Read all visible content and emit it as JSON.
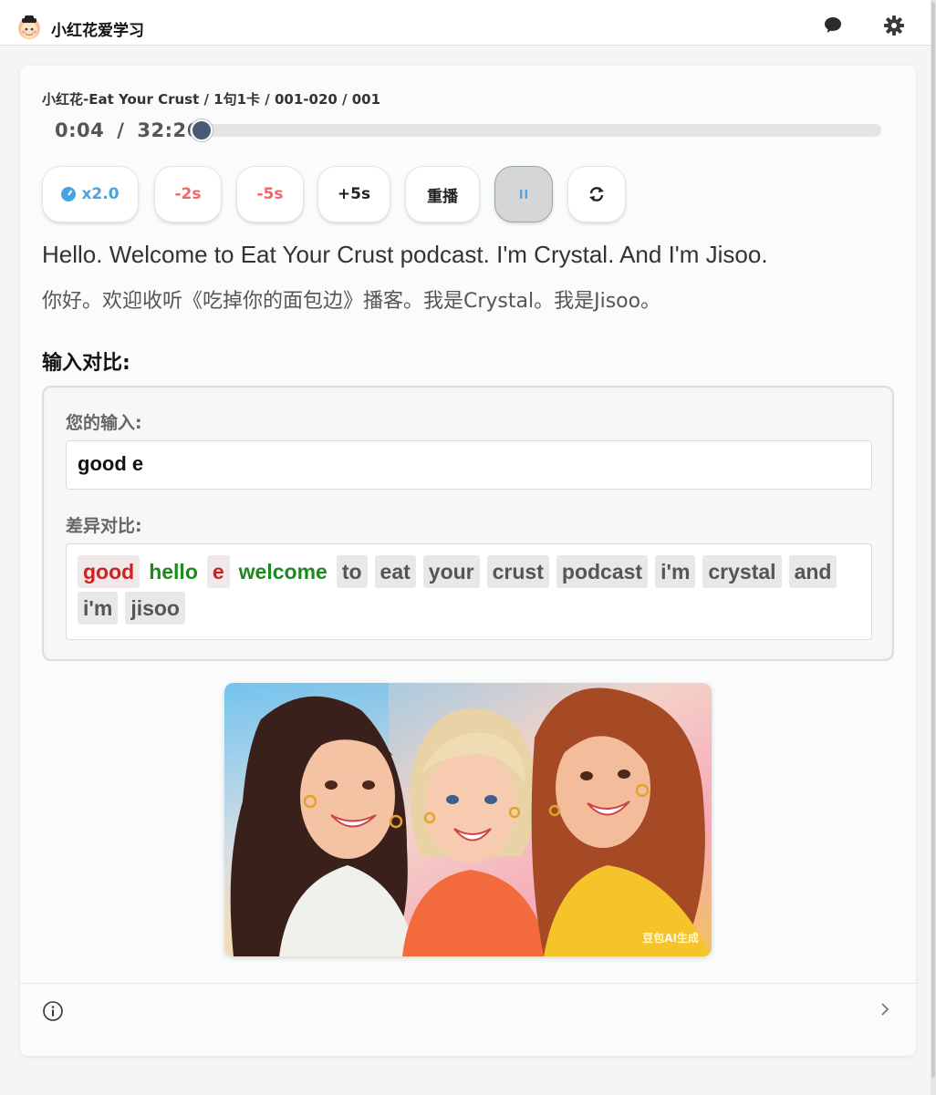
{
  "app": {
    "title": "小红花爱学习",
    "logo_icon": "avatar-logo-icon",
    "chat_icon": "chat-bubble-icon",
    "settings_icon": "gear-icon"
  },
  "player": {
    "breadcrumb": "小红花-Eat Your Crust / 1句1卡 / 001-020 / 001",
    "current_time": "0:04",
    "separator": "/",
    "total_time": "32:26",
    "progress": 0.002
  },
  "controls": {
    "speed_label": "x2.0",
    "back2_label": "-2s",
    "back5_label": "-5s",
    "fwd5_label": "+5s",
    "replay_label": "重播",
    "pause_icon": "pause-icon",
    "loop_icon": "repeat-icon"
  },
  "sentence": {
    "english": "Hello. Welcome to Eat Your Crust podcast. I'm Crystal. And I'm Jisoo.",
    "chinese": "你好。欢迎收听《吃掉你的面包边》播客。我是Crystal。我是Jisoo。"
  },
  "comparison": {
    "section_title": "输入对比:",
    "input_label": "您的输入:",
    "input_value": "good e",
    "diff_label": "差异对比:",
    "diff_words": [
      {
        "text": "good",
        "status": "extra"
      },
      {
        "text": "hello",
        "status": "missing"
      },
      {
        "text": "e",
        "status": "extra"
      },
      {
        "text": "welcome",
        "status": "missing"
      },
      {
        "text": "to",
        "status": "same"
      },
      {
        "text": "eat",
        "status": "same"
      },
      {
        "text": "your",
        "status": "same"
      },
      {
        "text": "crust",
        "status": "same"
      },
      {
        "text": "podcast",
        "status": "same"
      },
      {
        "text": "i'm",
        "status": "same"
      },
      {
        "text": "crystal",
        "status": "same"
      },
      {
        "text": "and",
        "status": "same"
      },
      {
        "text": "i'm",
        "status": "same"
      },
      {
        "text": "jisoo",
        "status": "same"
      }
    ]
  },
  "illustration": {
    "watermark": "豆包AI生成"
  },
  "footer": {
    "info_icon": "info-icon",
    "next_icon": "chevron-right-icon"
  },
  "colors": {
    "accent_blue": "#4aa3e0",
    "danger_red": "#ee6666",
    "diff_extra": "#cc2222",
    "diff_missing": "#1e8a1e",
    "knob": "#4a5a75"
  }
}
